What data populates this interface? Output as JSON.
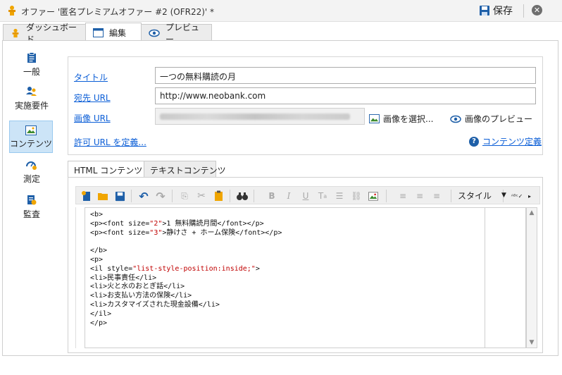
{
  "window": {
    "title": "オファー '匿名プレミアムオファー #2 (OFR22)' *",
    "save_label": "保存"
  },
  "tabs": [
    {
      "label": "ダッシュボード",
      "icon": "dashboard-icon"
    },
    {
      "label": "編集",
      "icon": "edit-window-icon",
      "active": true
    },
    {
      "label": "プレビュー",
      "icon": "eye-icon"
    }
  ],
  "sidebar": {
    "items": [
      {
        "label": "一般",
        "icon": "clipboard-icon"
      },
      {
        "label": "実施要件",
        "icon": "users-icon"
      },
      {
        "label": "コンテンツ",
        "icon": "image-icon",
        "active": true
      },
      {
        "label": "測定",
        "icon": "measure-icon"
      },
      {
        "label": "監査",
        "icon": "audit-icon"
      }
    ]
  },
  "form": {
    "title_label": "タイトル",
    "title_value": "一つの無料購読の月",
    "dest_label": "宛先 URL",
    "dest_value": "http://www.neobank.com",
    "image_label": "画像 URL",
    "select_image": "画像を選択...",
    "preview_image": "画像のプレビュー",
    "allowed_url": "許可 URL を定義...",
    "content_def": "コンテンツ定義"
  },
  "content_tabs": [
    {
      "label": "HTML コンテンツ",
      "active": true
    },
    {
      "label": "テキストコンテンツ"
    }
  ],
  "toolbar": {
    "style_label": "スタイル"
  },
  "code": {
    "l1": "<b>",
    "l2a": "<p><font size=",
    "l2s": "\"2\"",
    "l2b": ">1 無料購読月間</font></p>",
    "l3a": "<p><font size=",
    "l3s": "\"3\"",
    "l3b": ">静けさ + ホーム保険</font></p>",
    "l4": "</b>",
    "l5": "<p>",
    "l6a": "<il style=",
    "l6s": "\"list-style-position:inside;\"",
    "l6b": ">",
    "l7": "<li>民事責任</li>",
    "l8": "<li>火と水のおとぎ話</li>",
    "l9": "<li>お支払い方法の保険</li>",
    "l10": "<li>カスタマイズされた現金設備</li>",
    "l11": "</il>",
    "l12": "</p>"
  },
  "colors": {
    "link": "#0b5ed7",
    "selected_bg": "#cce4f7",
    "code_string": "#c00000"
  }
}
